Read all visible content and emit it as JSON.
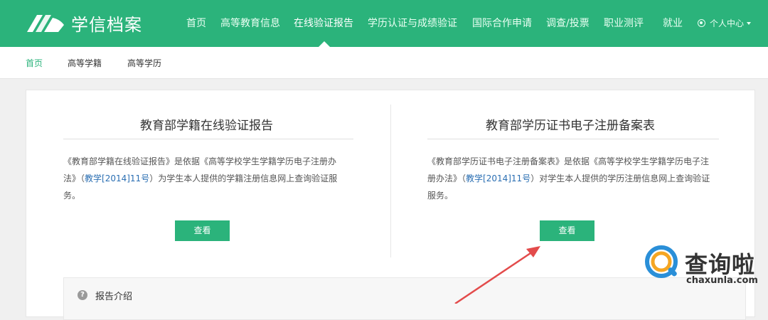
{
  "header": {
    "site_name": "学信档案",
    "nav": [
      {
        "label": "首页"
      },
      {
        "label": "高等教育信息"
      },
      {
        "label": "在线验证报告"
      },
      {
        "label": "学历认证与成绩验证"
      },
      {
        "label": "国际合作申请"
      },
      {
        "label": "调查/投票"
      },
      {
        "label": "职业测评"
      },
      {
        "label": "就业"
      }
    ],
    "user_menu": "个人中心",
    "brand_color": "#2bb37b"
  },
  "subnav": {
    "items": [
      {
        "label": "首页"
      },
      {
        "label": "高等学籍"
      },
      {
        "label": "高等学历"
      }
    ]
  },
  "left": {
    "title": "教育部学籍在线验证报告",
    "desc_a": "《教育部学籍在线验证报告》是依据《高等学校学生学籍学历电子注册办",
    "desc_b_pre": "法》（",
    "desc_b_link": "教学[2014]11号",
    "desc_b_post": "）为学生本人提供的学籍注册信息网上查询验证服",
    "desc_c": "务。",
    "button": "查看"
  },
  "right": {
    "title": "教育部学历证书电子注册备案表",
    "desc_a": "《教育部学历证书电子注册备案表》是依据《高等学校学生学籍学历电子注",
    "desc_b_pre": "册办法》（",
    "desc_b_link": "教学[2014]11号",
    "desc_b_post": "）对学生本人提供的学历注册信息网上查询验证",
    "desc_c": "服务。",
    "button": "查看"
  },
  "intro": {
    "icon": "?",
    "label": "报告介绍"
  },
  "watermark": {
    "text": "查询啦",
    "url": "chaxunla.com"
  }
}
